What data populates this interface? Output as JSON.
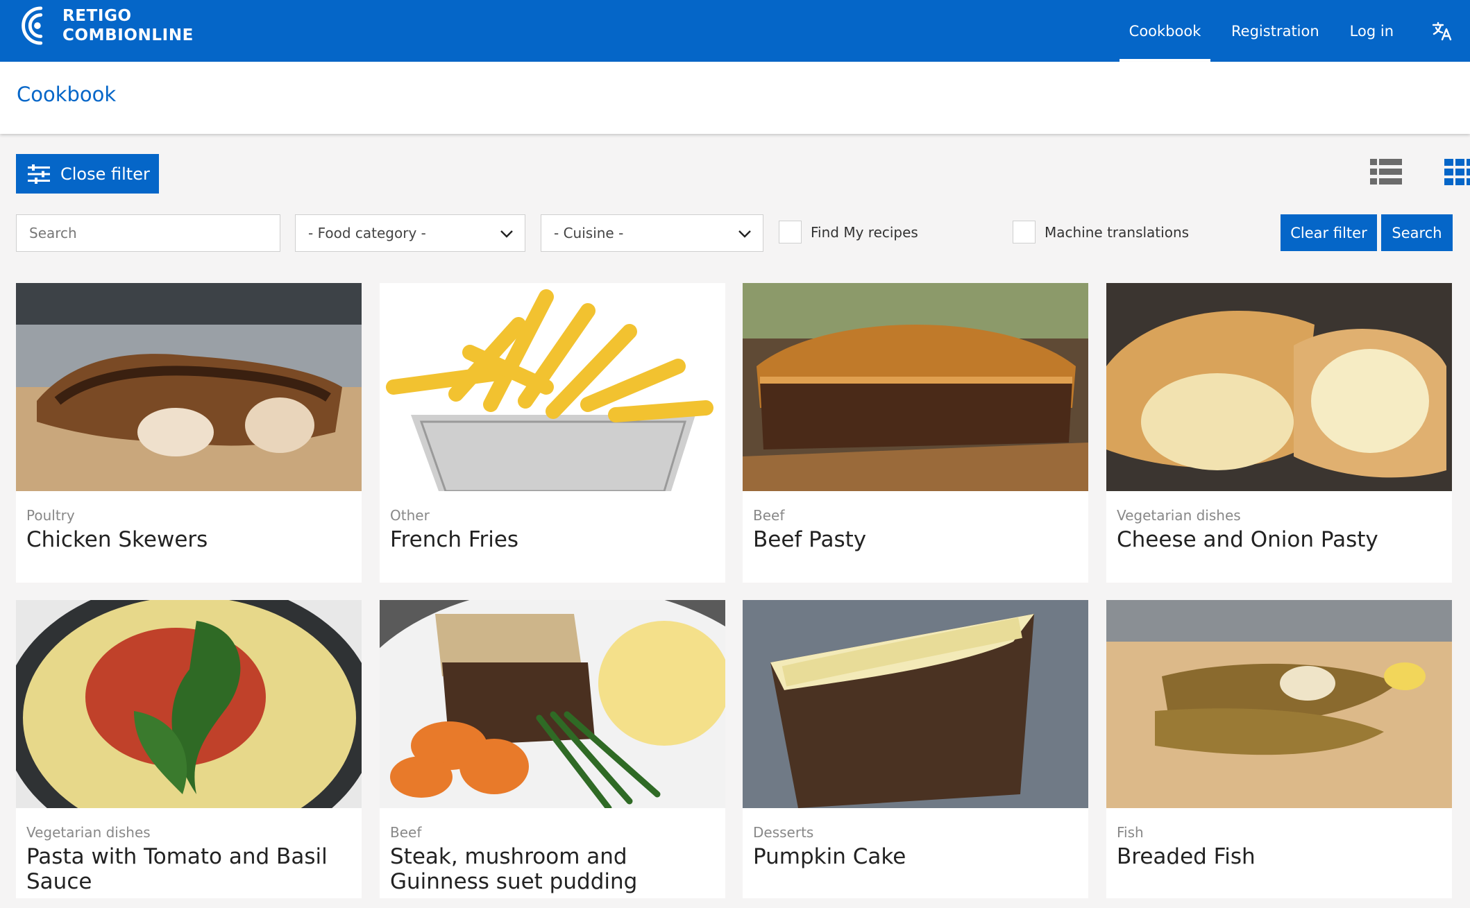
{
  "brand": {
    "line1": "RETIGO",
    "line2": "COMBIONLINE"
  },
  "nav": {
    "items": [
      "Cookbook",
      "Registration",
      "Log in"
    ],
    "translate_icon": "translate-icon"
  },
  "page": {
    "title": "Cookbook"
  },
  "filter": {
    "close_label": "Close filter",
    "search_placeholder": "Search",
    "food_category": "- Food category -",
    "cuisine": "- Cuisine -",
    "find_my_recipes": "Find My recipes",
    "machine_translations": "Machine translations",
    "clear_label": "Clear filter",
    "search_label": "Search"
  },
  "colors": {
    "primary": "#0566c8",
    "background": "#f5f4f4"
  },
  "recipes": [
    {
      "category": "Poultry",
      "name": "Chicken Skewers"
    },
    {
      "category": "Other",
      "name": "French Fries"
    },
    {
      "category": "Beef",
      "name": "Beef Pasty"
    },
    {
      "category": "Vegetarian dishes",
      "name": "Cheese and Onion Pasty"
    },
    {
      "category": "Vegetarian dishes",
      "name": "Pasta with Tomato and Basil Sauce"
    },
    {
      "category": "Beef",
      "name": "Steak, mushroom and Guinness suet pudding"
    },
    {
      "category": "Desserts",
      "name": "Pumpkin Cake"
    },
    {
      "category": "Fish",
      "name": "Breaded Fish"
    }
  ]
}
